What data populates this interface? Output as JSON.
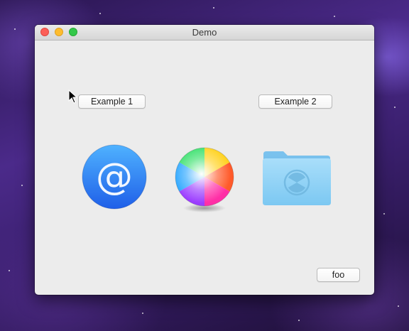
{
  "window": {
    "title": "Demo"
  },
  "buttons": {
    "example1": "Example 1",
    "example2": "Example 2",
    "foo": "foo"
  },
  "icons": {
    "first": "at-sign-mail-icon",
    "second": "color-wheel-icon",
    "third": "folder-icon"
  },
  "colors": {
    "window_bg": "#ececec",
    "close": "#fc5f57",
    "minimize": "#fdbc2e",
    "zoom": "#34c84a",
    "mail_icon_blue": "#2f7ef5",
    "folder_blue": "#8fd0f5"
  }
}
